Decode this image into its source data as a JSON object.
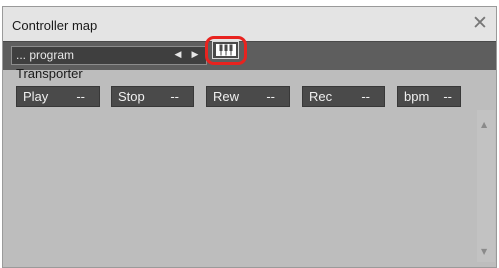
{
  "window": {
    "title": "Controller map",
    "close_glyph": "✕"
  },
  "toolbar": {
    "program_value": "... program",
    "prev_glyph": "◀",
    "next_glyph": "▶",
    "keyboard_icon": "piano-keyboard-icon",
    "highlight_color": "#e8231f"
  },
  "section": {
    "label": "Transporter"
  },
  "controls": [
    {
      "name": "Play",
      "value": "--"
    },
    {
      "name": "Stop",
      "value": "--"
    },
    {
      "name": "Rew",
      "value": "--"
    },
    {
      "name": "Rec",
      "value": "--"
    },
    {
      "name": "bpm",
      "value": "--"
    }
  ],
  "scrollbar": {
    "up_glyph": "▲",
    "down_glyph": "▼"
  }
}
